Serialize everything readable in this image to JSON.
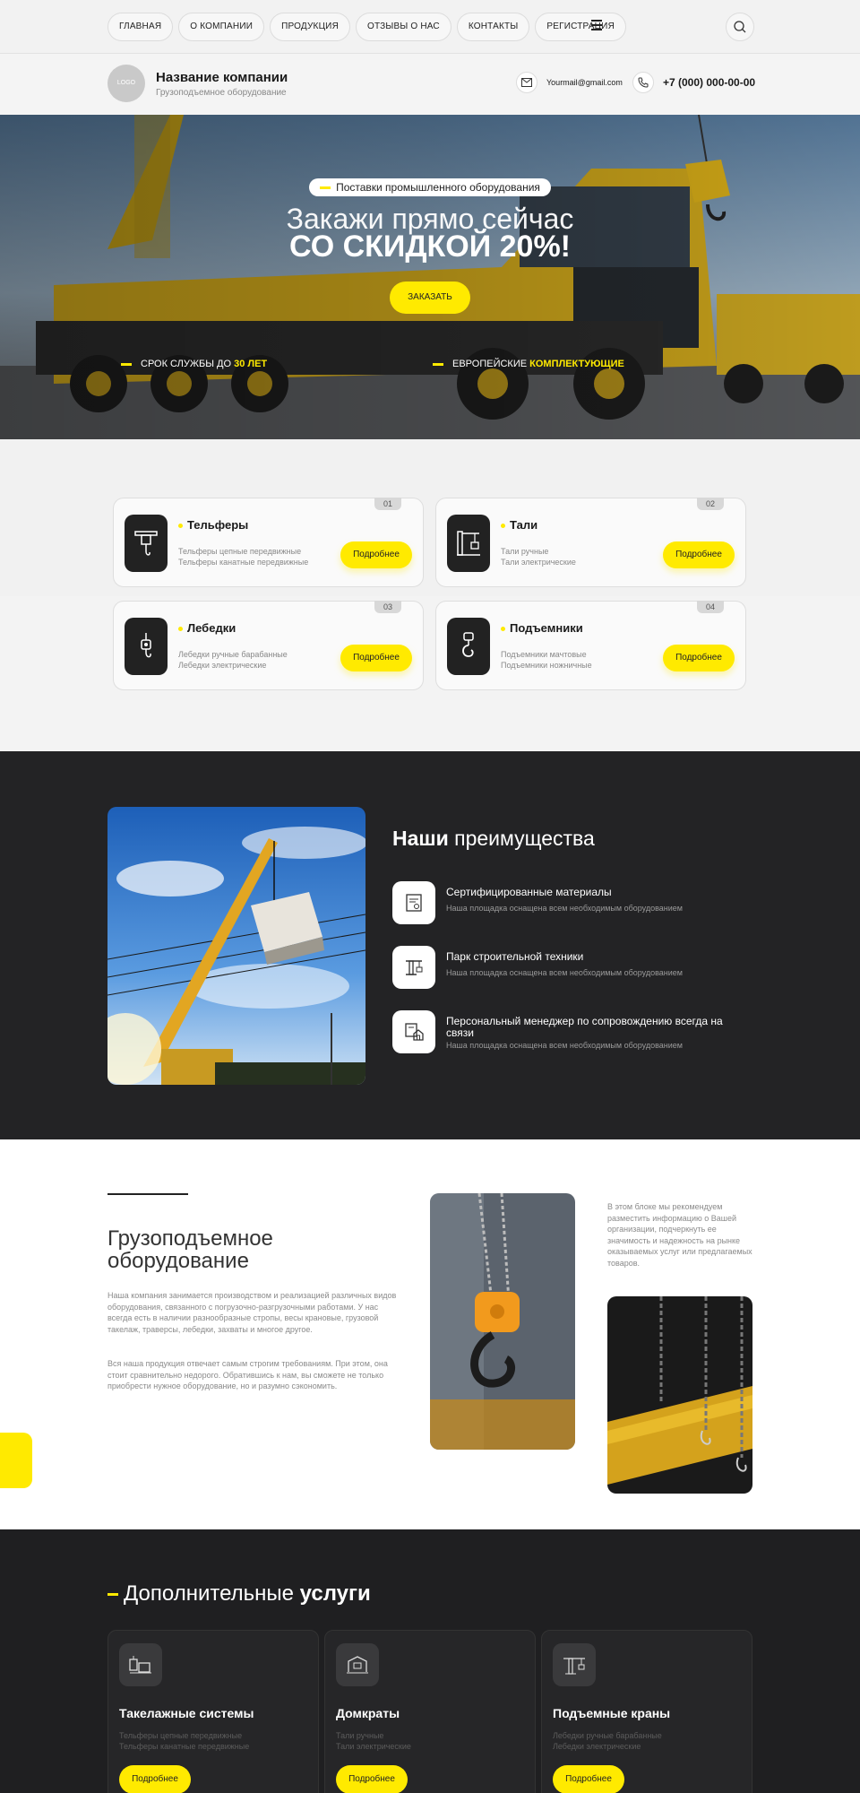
{
  "nav": {
    "items": [
      "ГЛАВНАЯ",
      "О КОМПАНИИ",
      "ПРОДУКЦИЯ",
      "ОТЗЫВЫ О НАС",
      "КОНТАКТЫ",
      "РЕГИСТРАЦИЯ"
    ],
    "menu_icon": "menu-icon",
    "search_icon": "search-icon"
  },
  "header": {
    "logo_text": "LOGO",
    "company_name": "Название компании",
    "company_sub": "Грузоподъемное оборудование",
    "email": "Yourmail@gmail.com",
    "phone": "+7 (000) 000-00-00"
  },
  "hero": {
    "tag": "Поставки промышленного оборудования",
    "line1": "Закажи прямо сейчас",
    "line2": "СО СКИДКОЙ 20%!",
    "button": "ЗАКАЗАТЬ",
    "feature1_text": "СРОК СЛУЖБЫ ДО ",
    "feature1_highlight": "30 ЛЕТ",
    "feature2_text": "ЕВРОПЕЙСКИЕ ",
    "feature2_highlight": "КОМПЛЕКТУЮЩИЕ"
  },
  "products": [
    {
      "num": "01",
      "title": "Тельферы",
      "line1": "Тельферы цепные передвижные",
      "line2": "Тельферы канатные передвижные",
      "button": "Подробнее",
      "icon": "hoist-icon"
    },
    {
      "num": "02",
      "title": "Тали",
      "line1": "Тали ручные",
      "line2": "Тали электрические",
      "button": "Подробнее",
      "icon": "crane-tower-icon"
    },
    {
      "num": "03",
      "title": "Лебедки",
      "line1": "Лебедки ручные барабанные",
      "line2": "Лебедки электрические",
      "button": "Подробнее",
      "icon": "winch-icon"
    },
    {
      "num": "04",
      "title": "Подъемники",
      "line1": "Подъемники мачтовые",
      "line2": "Подъемники ножничные",
      "button": "Подробнее",
      "icon": "hook-icon"
    }
  ],
  "advantages": {
    "title_bold": "Наши",
    "title_rest": " преимущества",
    "items": [
      {
        "title": "Сертифицированные материалы",
        "desc": "Наша площадка оснащена всем необходимым оборудованием",
        "icon": "certificate-icon"
      },
      {
        "title": "Парк строительной техники",
        "desc": "Наша площадка оснащена всем необходимым оборудованием",
        "icon": "crane-icon"
      },
      {
        "title": "Персональный менеджер по сопровождению всегда на связи",
        "desc": "Наша площадка оснащена всем необходимым оборудованием",
        "icon": "manager-icon"
      }
    ]
  },
  "about": {
    "title": "Грузоподъемное оборудование",
    "p1": "Наша компания занимается производством и реализацией различных видов оборудования, связанного с погрузочно-разгрузочными работами. У нас всегда есть в наличии разнообразные стропы, весы крановые, грузовой такелаж, траверсы, лебедки, захваты и многое другое.",
    "p2": "Вся наша продукция отвечает самым строгим требованиям. При этом, она стоит сравнительно недорого. Обратившись к нам, вы сможете не только приобрести нужное оборудование, но и разумно сэкономить.",
    "side": "В этом блоке мы рекомендуем разместить информацию о Вашей организации, подчеркнуть ее значимость и надежность на рынке оказываемых услуг или предлагаемых товаров."
  },
  "services": {
    "title_rest": "Дополнительные ",
    "title_bold": "услуги",
    "items": [
      {
        "name": "Такелажные системы",
        "line1": "Тельферы цепные передвижные",
        "line2": "Тельферы канатные передвижные",
        "button": "Подробнее",
        "icon": "rigging-icon"
      },
      {
        "name": "Домкраты",
        "line1": "Тали ручные",
        "line2": "Тали электрические",
        "button": "Подробнее",
        "icon": "jack-icon"
      },
      {
        "name": "Подъемные краны",
        "line1": "Лебедки ручные барабанные",
        "line2": "Лебедки электрические",
        "button": "Подробнее",
        "icon": "tower-crane-icon"
      }
    ]
  },
  "colors": {
    "accent": "#ffea00",
    "dark": "#232325"
  }
}
